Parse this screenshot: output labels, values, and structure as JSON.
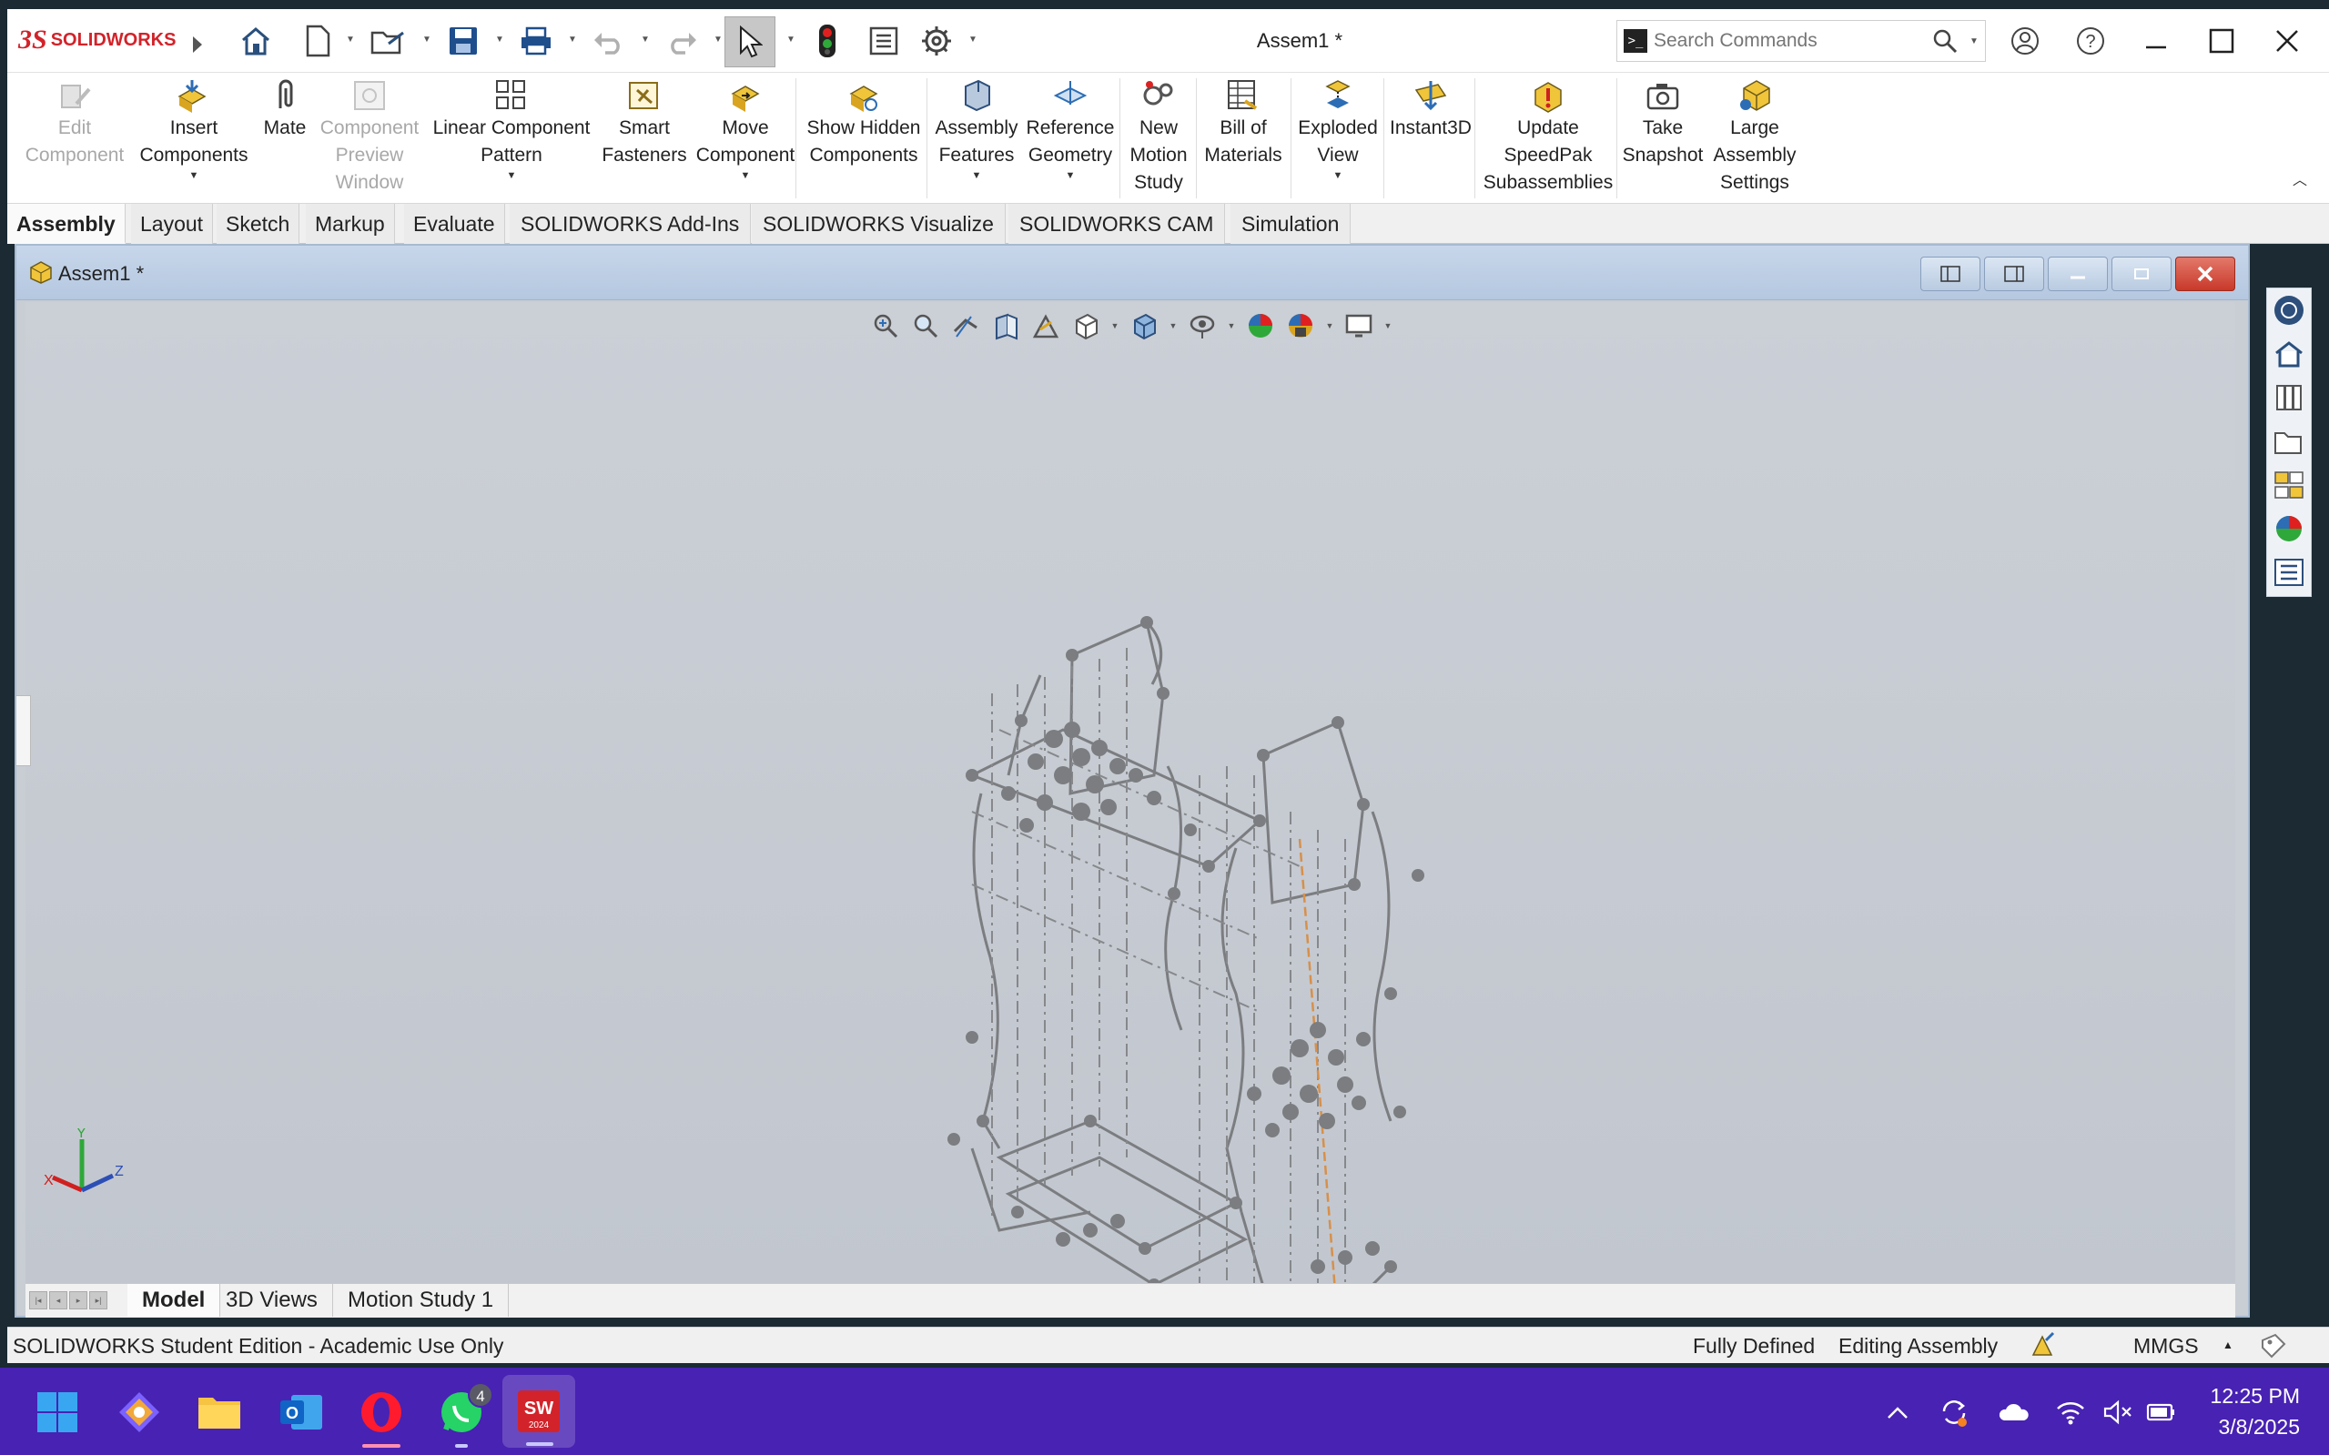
{
  "app": {
    "brand": "SOLIDWORKS",
    "brand_color": "#d2232a",
    "doc_title": "Assem1 *"
  },
  "search": {
    "placeholder": "Search Commands"
  },
  "ribbon": [
    {
      "label": "Edit Component",
      "enabled": false,
      "icon": "edit-component-icon"
    },
    {
      "label": "Insert Components",
      "enabled": true,
      "icon": "insert-components-icon",
      "dropdown": true
    },
    {
      "label": "Mate",
      "enabled": true,
      "icon": "mate-icon"
    },
    {
      "label": "Component Preview Window",
      "enabled": false,
      "icon": "component-preview-icon"
    },
    {
      "label": "Linear Component Pattern",
      "enabled": true,
      "icon": "linear-pattern-icon",
      "dropdown": true
    },
    {
      "label": "Smart Fasteners",
      "enabled": true,
      "icon": "smart-fasteners-icon"
    },
    {
      "label": "Move Component",
      "enabled": true,
      "icon": "move-component-icon",
      "dropdown": true
    },
    {
      "label": "Show Hidden Components",
      "enabled": true,
      "icon": "show-hidden-icon"
    },
    {
      "label": "Assembly Features",
      "enabled": true,
      "icon": "assembly-features-icon",
      "dropdown": true
    },
    {
      "label": "Reference Geometry",
      "enabled": true,
      "icon": "reference-geometry-icon",
      "dropdown": true
    },
    {
      "label": "New Motion Study",
      "enabled": true,
      "icon": "motion-study-icon"
    },
    {
      "label": "Bill of Materials",
      "enabled": true,
      "icon": "bill-of-materials-icon"
    },
    {
      "label": "Exploded View",
      "enabled": true,
      "icon": "exploded-view-icon",
      "dropdown": true
    },
    {
      "label": "Instant3D",
      "enabled": true,
      "icon": "instant3d-icon"
    },
    {
      "label": "Update SpeedPak Subassemblies",
      "enabled": true,
      "icon": "speedpak-icon"
    },
    {
      "label": "Take Snapshot",
      "enabled": true,
      "icon": "camera-icon"
    },
    {
      "label": "Large Assembly Settings",
      "enabled": true,
      "icon": "large-assembly-icon"
    }
  ],
  "tabs": [
    "Assembly",
    "Layout",
    "Sketch",
    "Markup",
    "Evaluate",
    "SOLIDWORKS Add-Ins",
    "SOLIDWORKS Visualize",
    "SOLIDWORKS CAM",
    "Simulation"
  ],
  "bottom_tabs": [
    "Model",
    "3D Views",
    "Motion Study 1"
  ],
  "triad": {
    "x": "X",
    "y": "Y",
    "z": "Z"
  },
  "status": {
    "edition": "SOLIDWORKS Student Edition - Academic Use Only",
    "defined": "Fully Defined",
    "mode": "Editing Assembly",
    "units": "MMGS"
  },
  "taskbar": {
    "whatsapp_badge": "4",
    "sw_label": "SW",
    "sw_version": "2024",
    "time": "12:25 PM",
    "date": "3/8/2025"
  }
}
